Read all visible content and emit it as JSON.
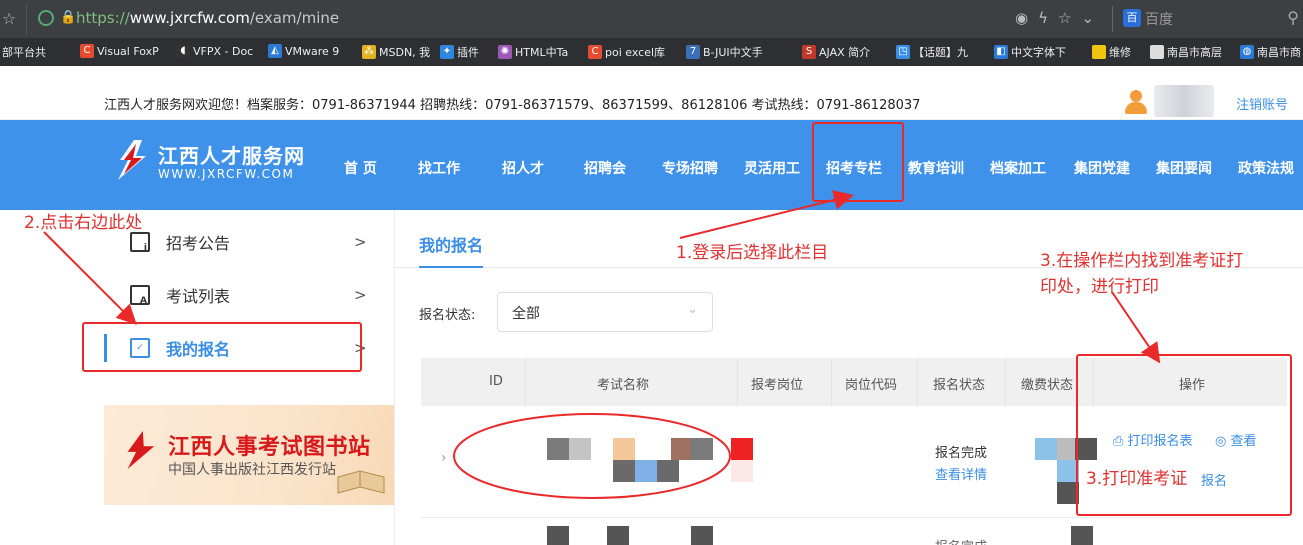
{
  "browser": {
    "url_scheme": "https://",
    "url_host": "www.jxrcfw.com",
    "url_path": "/exam/mine",
    "search_engine": "百度"
  },
  "bookmarks": [
    "部平台共",
    "Visual FoxP",
    "VFPX - Doc",
    "VMware 9",
    "MSDN, 我",
    "插件",
    "HTML中Ta",
    "poi excel库",
    "B-JUI中文手",
    "AJAX 简介",
    "【话题】九",
    "中文字体下",
    "维修",
    "南昌市高层",
    "南昌市商"
  ],
  "topbar": {
    "hotline": "江西人才服务网欢迎您！档案服务：0791-86371944 招聘热线：0791-86371579、86371599、86128106 考试热线：0791-86128037",
    "logout": "注销账号"
  },
  "site": {
    "name": "江西人才服务网",
    "url": "WWW.JXRCFW.COM",
    "colors": {
      "primary": "#3f92ea",
      "accent": "#3a8ee6",
      "logo_red": "#d8191b",
      "annotation": "#ea2a2a"
    }
  },
  "nav": [
    "首 页",
    "找工作",
    "招人才",
    "招聘会",
    "专场招聘",
    "灵活用工",
    "招考专栏",
    "教育培训",
    "档案加工",
    "集团党建",
    "集团要闻",
    "政策法规"
  ],
  "sidebar": {
    "items": [
      {
        "label": "招考公告",
        "icon": "notice-icon"
      },
      {
        "label": "考试列表",
        "icon": "list-icon"
      },
      {
        "label": "我的报名",
        "icon": "check-icon"
      }
    ],
    "banner_title": "江西人事考试图书站",
    "banner_sub": "中国人事出版社江西发行站"
  },
  "main": {
    "tab": "我的报名",
    "filter_label": "报名状态:",
    "filter_value": "全部",
    "columns": [
      "ID",
      "考试名称",
      "报考岗位",
      "岗位代码",
      "报名状态",
      "缴费状态",
      "操作"
    ],
    "rows": [
      {
        "status": "报名完成",
        "detail_link": "查看详情",
        "op_print_form": "打印报名表",
        "op_view": "查看",
        "op_third_tail": "报名"
      },
      {
        "status": "报名完成"
      }
    ]
  },
  "annotations": {
    "a1": "1.登录后选择此栏目",
    "a2": "2.点击右边此处",
    "a3_line1": "3.在操作栏内找到准考证打",
    "a3_line2": "印处，进行打印",
    "a3_print": "3.打印准考证"
  }
}
